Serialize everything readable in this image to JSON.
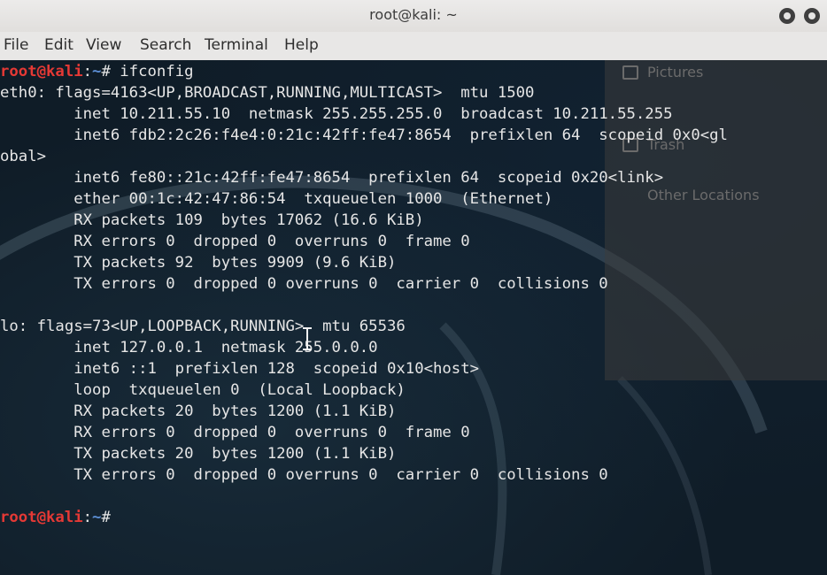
{
  "window": {
    "title": "root@kali: ~"
  },
  "menubar": {
    "items": [
      "File",
      "Edit",
      "View",
      "Search",
      "Terminal",
      "Help"
    ]
  },
  "background_panel": {
    "items": [
      "Pictures",
      "Trash",
      "Other Locations"
    ]
  },
  "prompt": {
    "user": "root@kali",
    "sep": ":",
    "path": "~",
    "symbol": "#"
  },
  "command": " ifconfig",
  "output": [
    "eth0: flags=4163<UP,BROADCAST,RUNNING,MULTICAST>  mtu 1500",
    "        inet 10.211.55.10  netmask 255.255.255.0  broadcast 10.211.55.255",
    "        inet6 fdb2:2c26:f4e4:0:21c:42ff:fe47:8654  prefixlen 64  scopeid 0x0<gl",
    "obal>",
    "        inet6 fe80::21c:42ff:fe47:8654  prefixlen 64  scopeid 0x20<link>",
    "        ether 00:1c:42:47:86:54  txqueuelen 1000  (Ethernet)",
    "        RX packets 109  bytes 17062 (16.6 KiB)",
    "        RX errors 0  dropped 0  overruns 0  frame 0",
    "        TX packets 92  bytes 9909 (9.6 KiB)",
    "        TX errors 0  dropped 0 overruns 0  carrier 0  collisions 0",
    "",
    "lo: flags=73<UP,LOOPBACK,RUNNING>  mtu 65536",
    "        inet 127.0.0.1  netmask 255.0.0.0",
    "        inet6 ::1  prefixlen 128  scopeid 0x10<host>",
    "        loop  txqueuelen 0  (Local Loopback)",
    "        RX packets 20  bytes 1200 (1.1 KiB)",
    "        RX errors 0  dropped 0  overruns 0  frame 0",
    "        TX packets 20  bytes 1200 (1.1 KiB)",
    "        TX errors 0  dropped 0 overruns 0  carrier 0  collisions 0",
    ""
  ],
  "colors": {
    "prompt_user": "#e53935",
    "prompt_path": "#5c8fd6",
    "terminal_bg": "#0f1c27",
    "text": "#e6e6e6"
  }
}
